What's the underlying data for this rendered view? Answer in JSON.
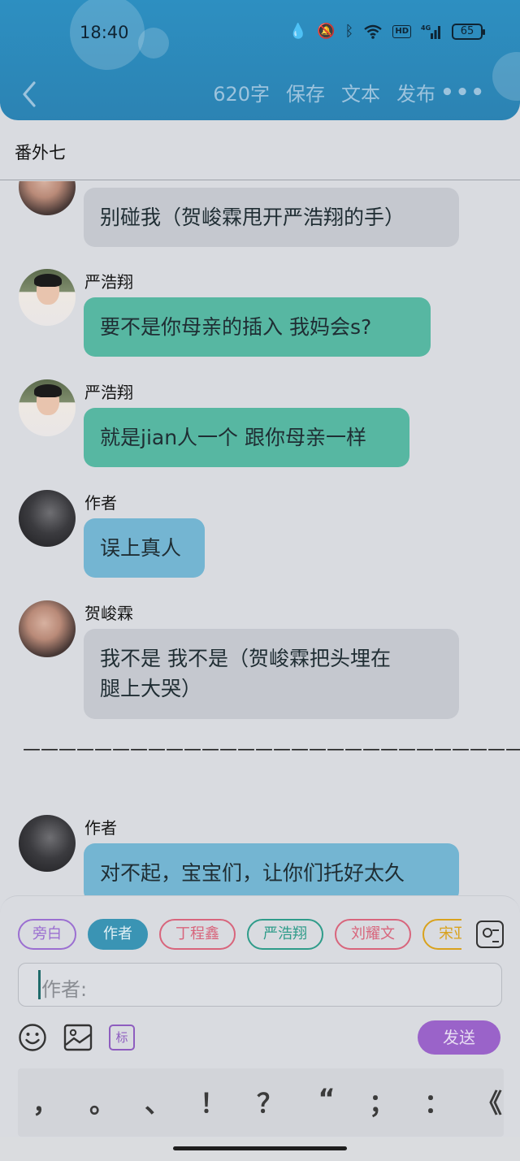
{
  "status": {
    "time": "18:40",
    "battery": "65",
    "network": "HD",
    "signal": "4G"
  },
  "nav": {
    "word_count": "620字",
    "save": "保存",
    "text": "文本",
    "publish": "发布",
    "more": "•••"
  },
  "chapter_title": "番外七",
  "messages": [
    {
      "speaker": "",
      "text": "别碰我（贺峻霖甩开严浩翔的手）",
      "style": "gray",
      "avatar": "he"
    },
    {
      "speaker": "严浩翔",
      "text": "要不是你母亲的插入 我妈会s?",
      "style": "teal",
      "avatar": "boy"
    },
    {
      "speaker": "严浩翔",
      "text": "就是jian人一个 跟你母亲一样",
      "style": "teal",
      "avatar": "boy"
    },
    {
      "speaker": "作者",
      "text": "误上真人",
      "style": "blue",
      "avatar": "dark"
    },
    {
      "speaker": "贺峻霖",
      "text_line1": "我不是 我不是（贺峻霖把头埋在",
      "text_line2": "腿上大哭）",
      "style": "gray",
      "avatar": "he"
    },
    {
      "speaker": "作者",
      "text": "对不起，宝宝们，让你们托好太久",
      "style": "blue",
      "avatar": "dark"
    }
  ],
  "divider_text": "————————————————————————————————————",
  "roles": [
    {
      "label": "旁白",
      "color": "#9b6fd1",
      "active": false
    },
    {
      "label": "作者",
      "color": "#3a94b4",
      "active": true
    },
    {
      "label": "丁程鑫",
      "color": "#d8657c",
      "active": false
    },
    {
      "label": "严浩翔",
      "color": "#2f9c8a",
      "active": false
    },
    {
      "label": "刘耀文",
      "color": "#d8657c",
      "active": false
    },
    {
      "label": "宋亚轩",
      "color": "#d9a21d",
      "active": false
    }
  ],
  "composer": {
    "placeholder": "作者:",
    "send_label": "发送",
    "tag_label": "标"
  },
  "punctuation": [
    "，",
    "。",
    "、",
    "！",
    "？",
    "“",
    "；",
    "：",
    "《"
  ]
}
